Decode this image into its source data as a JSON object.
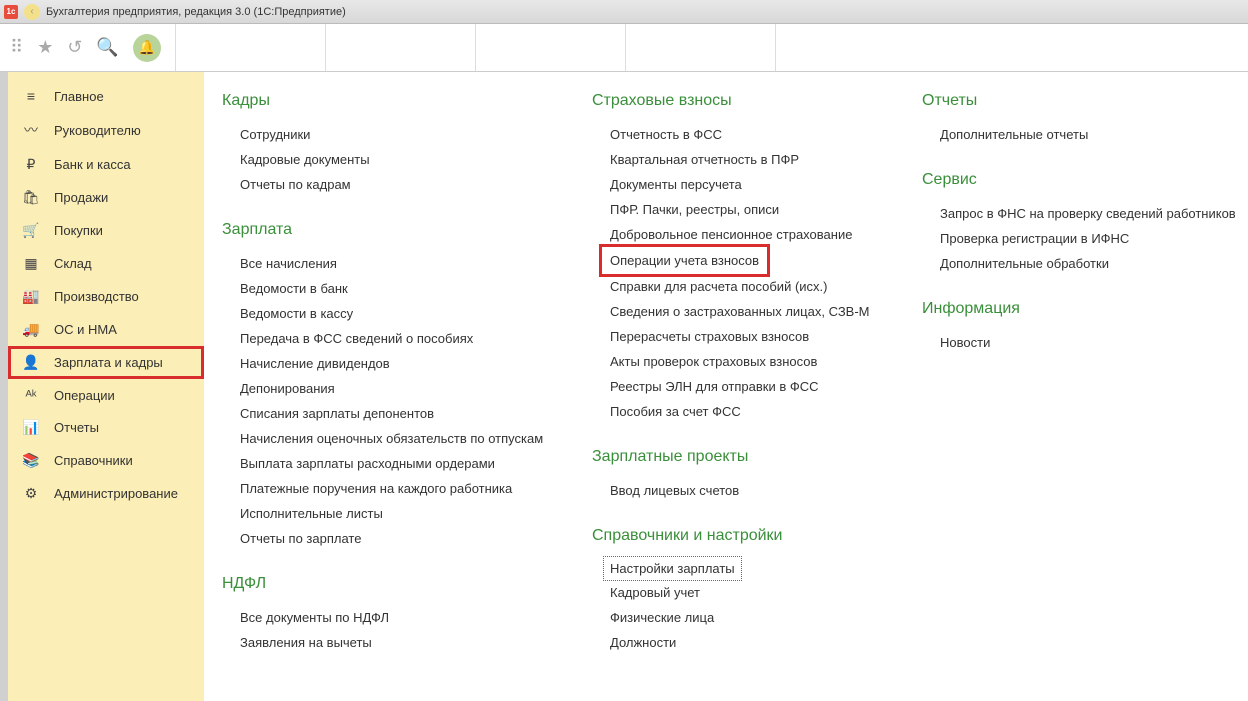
{
  "titlebar": {
    "title": "Бухгалтерия предприятия, редакция 3.0  (1С:Предприятие)"
  },
  "sidebar": {
    "items": [
      {
        "label": "Главное",
        "icon": "≡"
      },
      {
        "label": "Руководителю",
        "icon": "〰"
      },
      {
        "label": "Банк и касса",
        "icon": "₽"
      },
      {
        "label": "Продажи",
        "icon": "🛍"
      },
      {
        "label": "Покупки",
        "icon": "🛒"
      },
      {
        "label": "Склад",
        "icon": "▦"
      },
      {
        "label": "Производство",
        "icon": "🏭"
      },
      {
        "label": "ОС и НМА",
        "icon": "🚚"
      },
      {
        "label": "Зарплата и кадры",
        "icon": "👤",
        "selected": true
      },
      {
        "label": "Операции",
        "icon": "ᴬᵏ"
      },
      {
        "label": "Отчеты",
        "icon": "📊"
      },
      {
        "label": "Справочники",
        "icon": "📚"
      },
      {
        "label": "Администрирование",
        "icon": "⚙"
      }
    ]
  },
  "content": {
    "col1": [
      {
        "title": "Кадры",
        "links": [
          "Сотрудники",
          "Кадровые документы",
          "Отчеты по кадрам"
        ]
      },
      {
        "title": "Зарплата",
        "links": [
          "Все начисления",
          "Ведомости в банк",
          "Ведомости в кассу",
          "Передача в ФСС сведений о пособиях",
          "Начисление дивидендов",
          "Депонирования",
          "Списания зарплаты депонентов",
          "Начисления оценочных обязательств по отпускам",
          "Выплата зарплаты расходными ордерами",
          "Платежные поручения на каждого работника",
          "Исполнительные листы",
          "Отчеты по зарплате"
        ]
      },
      {
        "title": "НДФЛ",
        "links": [
          "Все документы по НДФЛ",
          "Заявления на вычеты"
        ]
      }
    ],
    "col2": [
      {
        "title": "Страховые взносы",
        "links": [
          "Отчетность в ФСС",
          "Квартальная отчетность в ПФР",
          "Документы персучета",
          "ПФР. Пачки, реестры, описи",
          "Добровольное пенсионное страхование",
          {
            "text": "Операции учета взносов",
            "redbox": true
          },
          "Справки для расчета пособий (исх.)",
          "Сведения о застрахованных лицах, СЗВ-М",
          "Перерасчеты страховых взносов",
          "Акты проверок страховых взносов",
          "Реестры ЭЛН для отправки в ФСС",
          "Пособия за счет ФСС"
        ]
      },
      {
        "title": "Зарплатные проекты",
        "links": [
          "Ввод лицевых счетов"
        ]
      },
      {
        "title": "Справочники и настройки",
        "links": [
          {
            "text": "Настройки зарплаты",
            "dotted": true
          },
          "Кадровый учет",
          "Физические лица",
          "Должности"
        ]
      }
    ],
    "col3": [
      {
        "title": "Отчеты",
        "links": [
          "Дополнительные отчеты"
        ]
      },
      {
        "title": "Сервис",
        "links": [
          "Запрос в ФНС на проверку сведений работников",
          "Проверка регистрации в ИФНС",
          "Дополнительные обработки"
        ]
      },
      {
        "title": "Информация",
        "links": [
          "Новости"
        ]
      }
    ]
  }
}
